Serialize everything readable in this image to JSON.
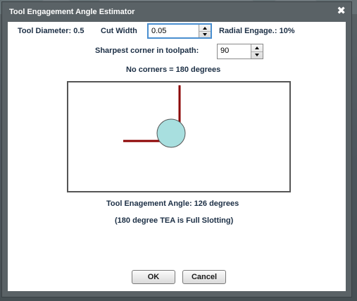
{
  "dialog": {
    "title": "Tool Engagement Angle Estimator",
    "close_glyph": "✖"
  },
  "fields": {
    "tool_diameter_label": "Tool Diameter: 0.5",
    "cut_width_label": "Cut Width",
    "cut_width_value": "0.05",
    "radial_engage_label": "Radial Engage.: 10%",
    "sharpest_corner_label": "Sharpest corner in toolpath:",
    "sharpest_corner_value": "90"
  },
  "info": {
    "no_corners_text": "No corners = 180 degrees",
    "tea_result_text": "Tool Enagement Angle: 126 degrees",
    "full_slotting_note": "(180 degree TEA is Full Slotting)"
  },
  "diagram": {
    "corner_angle_deg": 90,
    "path_color": "#8b0000",
    "tool_fill": "#a8dfdf",
    "tool_stroke": "#555555"
  },
  "buttons": {
    "ok_label": "OK",
    "cancel_label": "Cancel"
  },
  "icons": {
    "close": "close-icon",
    "spin_up": "triangle-up-icon",
    "spin_down": "triangle-down-icon"
  }
}
